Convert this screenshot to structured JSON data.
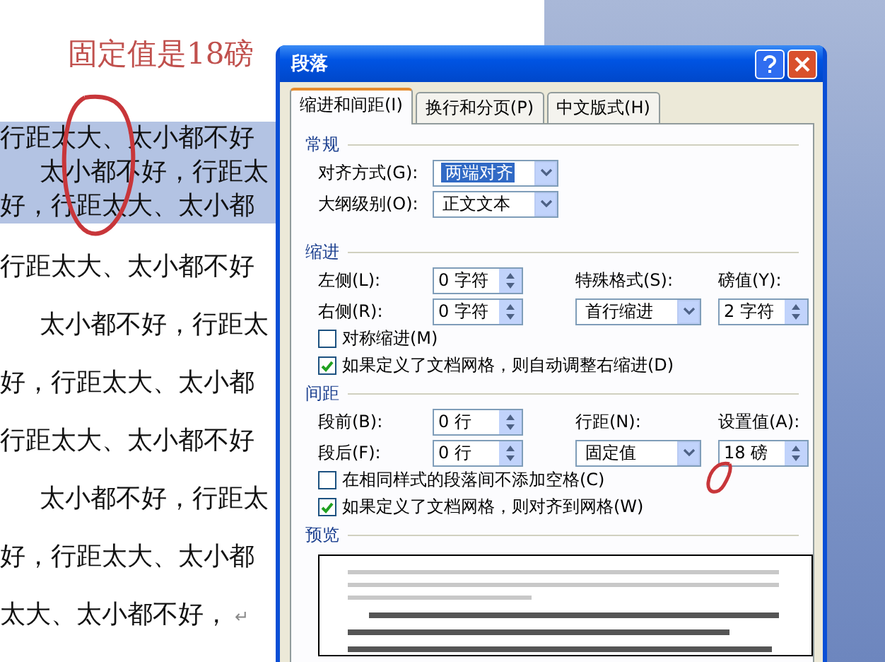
{
  "document": {
    "annotation": "固定值是18磅",
    "lines": [
      {
        "text": "行距太大、太小都不好",
        "selected": true,
        "indented": false
      },
      {
        "text": "太小都不好，行距太",
        "selected": true,
        "indented": true
      },
      {
        "text": "好，行距太大、太小都",
        "selected": true,
        "indented": false
      },
      {
        "text": "行距太大、太小都不好",
        "selected": false,
        "indented": false
      },
      {
        "text": "太小都不好，行距太",
        "selected": false,
        "indented": true
      },
      {
        "text": "好，行距太大、太小都",
        "selected": false,
        "indented": false
      },
      {
        "text": "行距太大、太小都不好",
        "selected": false,
        "indented": false
      },
      {
        "text": "太小都不好，行距太",
        "selected": false,
        "indented": true
      },
      {
        "text": "好，行距太大、太小都",
        "selected": false,
        "indented": false
      },
      {
        "text": "太大、太小都不好，",
        "selected": false,
        "indented": false,
        "mark": "↵"
      }
    ]
  },
  "dialog": {
    "title": "段落",
    "tabs": [
      {
        "label": "缩进和间距(I)",
        "selected": true
      },
      {
        "label": "换行和分页(P)",
        "selected": false
      },
      {
        "label": "中文版式(H)",
        "selected": false
      }
    ],
    "general": {
      "heading": "常规",
      "alignment": {
        "label": "对齐方式(G):",
        "value": "两端对齐",
        "focused": true
      },
      "outline": {
        "label": "大纲级别(O):",
        "value": "正文文本",
        "focused": false
      }
    },
    "indent": {
      "heading": "缩进",
      "left": {
        "label": "左侧(L):",
        "value": "0 字符"
      },
      "right": {
        "label": "右侧(R):",
        "value": "0 字符"
      },
      "special": {
        "label": "特殊格式(S):",
        "value": "首行缩进"
      },
      "by": {
        "label": "磅值(Y):",
        "value": "2 字符"
      },
      "checkboxes": [
        {
          "label": "对称缩进(M)",
          "checked": false
        },
        {
          "label": "如果定义了文档网格，则自动调整右缩进(D)",
          "checked": true
        }
      ]
    },
    "spacing": {
      "heading": "间距",
      "before": {
        "label": "段前(B):",
        "value": "0 行"
      },
      "after": {
        "label": "段后(F):",
        "value": "0 行"
      },
      "line_spacing": {
        "label": "行距(N):",
        "value": "固定值"
      },
      "at": {
        "label": "设置值(A):",
        "value": "18 磅"
      },
      "checkboxes": [
        {
          "label": "在相同样式的段落间不添加空格(C)",
          "checked": false
        },
        {
          "label": "如果定义了文档网格，则对齐到网格(W)",
          "checked": true
        }
      ]
    },
    "preview": {
      "heading": "预览"
    }
  }
}
